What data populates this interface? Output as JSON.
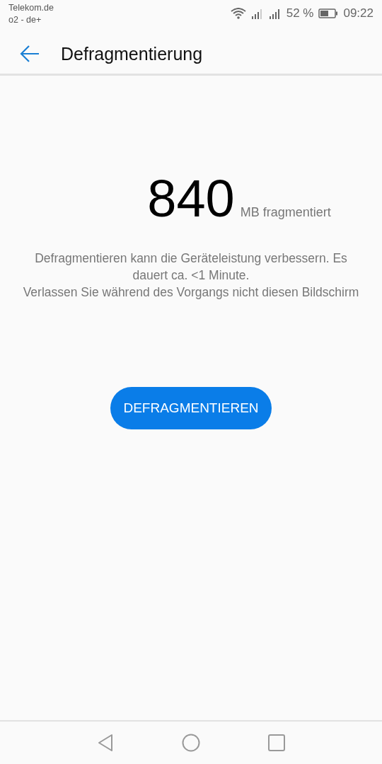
{
  "status_bar": {
    "carriers": [
      "Telekom.de",
      "o2 - de+"
    ],
    "battery": "52 %",
    "time": "09:22"
  },
  "app_bar": {
    "title": "Defragmentierung"
  },
  "summary": {
    "value": "840",
    "unit": "MB fragmentiert"
  },
  "description": [
    "Defragmentieren kann die Geräteleistung verbessern. Es dauert ca. <1 Minute.",
    "Verlassen Sie während des Vorgangs nicht diesen Bildschirm"
  ],
  "action_button": {
    "label": "DEFRAGMENTIEREN"
  }
}
